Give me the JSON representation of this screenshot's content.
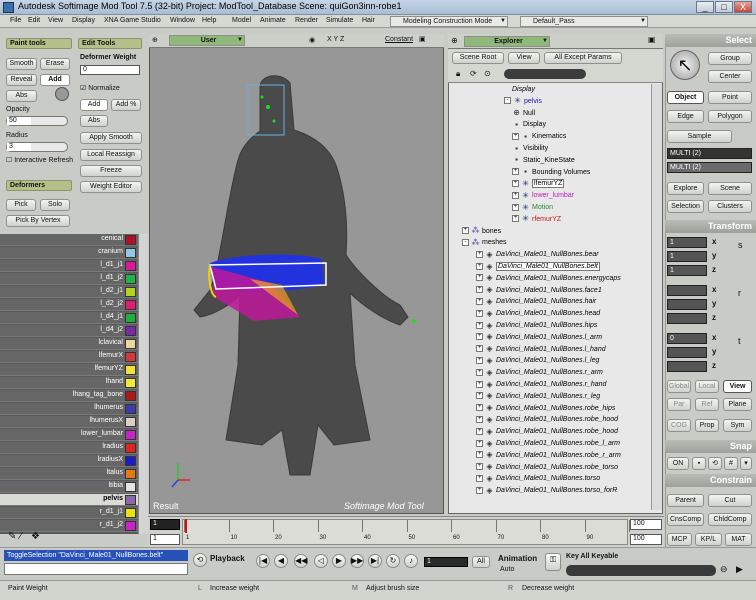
{
  "window": {
    "title": "Autodesk Softimage Mod Tool 7.5 (32-bit)    Project: ModTool_Database    Scene: quiGon3inn-robe1",
    "controls": [
      "_",
      "□",
      "X"
    ]
  },
  "menu": {
    "items": [
      "File",
      "Edit",
      "View",
      "Display",
      "XNA Game Studio",
      "Window",
      "Help",
      "Model",
      "Animate",
      "Render",
      "Simulate",
      "Hair"
    ],
    "mode": "Modeling Construction Mode",
    "pass": "Default_Pass"
  },
  "left": {
    "paint_tools": "Paint tools",
    "edit_tools": "Edit Tools",
    "smooth": "Smooth",
    "erase": "Erase",
    "deformer_weight": "Deformer Weight",
    "deformer_weight_value": "0",
    "reveal": "Reveal",
    "add": "Add",
    "normalize": "Normalize",
    "abs": "Abs",
    "opacity": "Opacity",
    "opacity_value": "50",
    "add2": "Add",
    "add_pct": "Add %",
    "radius": "Radius",
    "radius_value": "3",
    "abs2": "Abs",
    "apply_smooth": "Apply Smooth",
    "interactive_refresh": "Interactive Refresh",
    "local_reassign": "Local Reassign",
    "freeze": "Freeze",
    "deformers": "Deformers",
    "weight_editor": "Weight Editor",
    "pick": "Pick",
    "solo": "Solo",
    "pick_by_vertex": "Pick By Vertex"
  },
  "deformer_list": [
    {
      "name": "cenical",
      "color": "#b0102a"
    },
    {
      "name": "cranium",
      "color": "#8fc8e8"
    },
    {
      "name": "l_d1_j1",
      "color": "#d81a9a"
    },
    {
      "name": "l_d1_j2",
      "color": "#23b34a"
    },
    {
      "name": "l_d2_j1",
      "color": "#b3d41e"
    },
    {
      "name": "l_d2_j2",
      "color": "#e21b73"
    },
    {
      "name": "l_d4_j1",
      "color": "#1fae3a"
    },
    {
      "name": "l_d4_j2",
      "color": "#7a2aa6"
    },
    {
      "name": "lclavical",
      "color": "#e9d6a0"
    },
    {
      "name": "lfemurX",
      "color": "#d33a3a"
    },
    {
      "name": "lfemurYZ",
      "color": "#f0e23a"
    },
    {
      "name": "lhand",
      "color": "#f2e835"
    },
    {
      "name": "lhang_tag_bone",
      "color": "#a81a1a"
    },
    {
      "name": "lhumerus",
      "color": "#3b3ea8"
    },
    {
      "name": "lhumerusX",
      "color": "#d6d0c8"
    },
    {
      "name": "lower_lumbar",
      "color": "#c624c6"
    },
    {
      "name": "lradius",
      "color": "#e02525"
    },
    {
      "name": "lradiusX",
      "color": "#1c1cc8"
    },
    {
      "name": "ltalus",
      "color": "#e47a12"
    },
    {
      "name": "ltibia",
      "color": "#e3e3e3"
    },
    {
      "name": "pelvis",
      "color": "#8a6aa6",
      "selected": true
    },
    {
      "name": "r_d1_j1",
      "color": "#e9e312"
    },
    {
      "name": "r_d1_j2",
      "color": "#cc22cc"
    }
  ],
  "viewport": {
    "camera": "User",
    "axes": "X Y Z",
    "shading": "Constant",
    "result_label": "Result",
    "watermark": "Softimage Mod Tool"
  },
  "explorer": {
    "title": "Explorer",
    "scene_root": "Scene Root",
    "view": "View",
    "filter": "All Except Params",
    "tree": [
      {
        "label": "Display",
        "level": 4,
        "italic": true,
        "icon": "none",
        "color": "#000"
      },
      {
        "label": "pelvis",
        "level": 3,
        "expander": "-",
        "icon": "bone-icon",
        "color": "#1a1ab0"
      },
      {
        "label": "Null",
        "level": 4,
        "icon": "null-icon",
        "color": "#000"
      },
      {
        "label": "Display",
        "level": 4,
        "icon": "prop-icon",
        "color": "#000"
      },
      {
        "label": "Kinematics",
        "level": 4,
        "expander": "+",
        "icon": "prop-icon",
        "color": "#000"
      },
      {
        "label": "Visibility",
        "level": 4,
        "icon": "prop-icon",
        "color": "#000"
      },
      {
        "label": "Static_KineState",
        "level": 4,
        "icon": "prop-icon",
        "color": "#000"
      },
      {
        "label": "Bounding Volumes",
        "level": 4,
        "expander": "+",
        "icon": "prop-icon",
        "color": "#000"
      },
      {
        "label": "lfemurYZ",
        "level": 4,
        "expander": "+",
        "icon": "bone-icon",
        "color": "#000",
        "boxed": true
      },
      {
        "label": "lower_lumbar",
        "level": 4,
        "expander": "+",
        "icon": "bone-icon",
        "color": "#c01ac0"
      },
      {
        "label": "Motion",
        "level": 4,
        "expander": "+",
        "icon": "bone-icon",
        "color": "#2a8a2a"
      },
      {
        "label": "rfemurYZ",
        "level": 4,
        "expander": "+",
        "icon": "bone-icon",
        "color": "#c01a1a"
      },
      {
        "label": "bones",
        "level": 1,
        "expander": "+",
        "icon": "group-icon",
        "color": "#000"
      },
      {
        "label": "meshes",
        "level": 1,
        "expander": "-",
        "icon": "group-icon",
        "color": "#000"
      },
      {
        "label": "DaVinci_Male01_NullBones.bear",
        "level": 2,
        "expander": "+",
        "icon": "mesh-icon",
        "italic": true,
        "color": "#000"
      },
      {
        "label": "DaVinci_Male01_NullBones.belt",
        "level": 2,
        "expander": "+",
        "icon": "mesh-icon",
        "italic": true,
        "color": "#000",
        "boxed": true
      },
      {
        "label": "DaVinci_Male01_NullBones.energycaps",
        "level": 2,
        "expander": "+",
        "icon": "mesh-icon",
        "italic": true,
        "color": "#000"
      },
      {
        "label": "DaVinci_Male01_NullBones.face1",
        "level": 2,
        "expander": "+",
        "icon": "mesh-icon",
        "italic": true,
        "color": "#000"
      },
      {
        "label": "DaVinci_Male01_NullBones.hair",
        "level": 2,
        "expander": "+",
        "icon": "mesh-icon",
        "italic": true,
        "color": "#000"
      },
      {
        "label": "DaVinci_Male01_NullBones.head",
        "level": 2,
        "expander": "+",
        "icon": "mesh-icon",
        "italic": true,
        "color": "#000"
      },
      {
        "label": "DaVinci_Male01_NullBones.hips",
        "level": 2,
        "expander": "+",
        "icon": "mesh-icon",
        "italic": true,
        "color": "#000"
      },
      {
        "label": "DaVinci_Male01_NullBones.l_arm",
        "level": 2,
        "expander": "+",
        "icon": "mesh-icon",
        "italic": true,
        "color": "#000"
      },
      {
        "label": "DaVinci_Male01_NullBones.l_hand",
        "level": 2,
        "expander": "+",
        "icon": "mesh-icon",
        "italic": true,
        "color": "#000"
      },
      {
        "label": "DaVinci_Male01_NullBones.l_leg",
        "level": 2,
        "expander": "+",
        "icon": "mesh-icon",
        "italic": true,
        "color": "#000"
      },
      {
        "label": "DaVinci_Male01_NullBones.r_arm",
        "level": 2,
        "expander": "+",
        "icon": "mesh-icon",
        "italic": true,
        "color": "#000"
      },
      {
        "label": "DaVinci_Male01_NullBones.r_hand",
        "level": 2,
        "expander": "+",
        "icon": "mesh-icon",
        "italic": true,
        "color": "#000"
      },
      {
        "label": "DaVinci_Male01_NullBones.r_leg",
        "level": 2,
        "expander": "+",
        "icon": "mesh-icon",
        "italic": true,
        "color": "#000"
      },
      {
        "label": "DaVinci_Male01_NullBones.robe_hips",
        "level": 2,
        "expander": "+",
        "icon": "mesh-icon",
        "italic": true,
        "color": "#000"
      },
      {
        "label": "DaVinci_Male01_NullBones.robe_hood",
        "level": 2,
        "expander": "+",
        "icon": "mesh-icon",
        "italic": true,
        "color": "#000"
      },
      {
        "label": "DaVinci_Male01_NullBones.robe_hood",
        "level": 2,
        "expander": "+",
        "icon": "mesh-icon",
        "italic": true,
        "color": "#000"
      },
      {
        "label": "DaVinci_Male01_NullBones.robe_l_arm",
        "level": 2,
        "expander": "+",
        "icon": "mesh-icon",
        "italic": true,
        "color": "#000"
      },
      {
        "label": "DaVinci_Male01_NullBones.robe_r_arm",
        "level": 2,
        "expander": "+",
        "icon": "mesh-icon",
        "italic": true,
        "color": "#000"
      },
      {
        "label": "DaVinci_Male01_NullBones.robe_torso",
        "level": 2,
        "expander": "+",
        "icon": "mesh-icon",
        "italic": true,
        "color": "#000"
      },
      {
        "label": "DaVinci_Male01_NullBones.torso",
        "level": 2,
        "expander": "+",
        "icon": "mesh-icon",
        "italic": true,
        "color": "#000"
      },
      {
        "label": "DaVinci_Male01_NullBones.torso_forR",
        "level": 2,
        "expander": "+",
        "icon": "mesh-icon",
        "italic": true,
        "color": "#000"
      }
    ]
  },
  "right": {
    "select": "Select",
    "group": "Group",
    "center": "Center",
    "object": "Object",
    "point": "Point",
    "edge": "Edge",
    "polygon": "Polygon",
    "sample": "Sample",
    "multi1": "MULTI (2)",
    "multi2": "MULTI (2)",
    "explore": "Explore",
    "scene": "Scene",
    "selection": "Selection",
    "clusters": "Clusters",
    "transform": "Transform",
    "x": "x",
    "y": "y",
    "z": "z",
    "scl_x": "1",
    "scl_y": "1",
    "scl_z": "1",
    "rot_x": "0",
    "pos_x": "0",
    "global": "Global",
    "local": "Local",
    "view": "View",
    "par": "Par",
    "ref": "Ref",
    "plane": "Plane",
    "cog": "COG",
    "prop": "Prop",
    "sym": "Sym",
    "snap": "Snap",
    "on": "ON",
    "constrain": "Constrain",
    "parent": "Parent",
    "cut": "Cut",
    "cnscomp": "CnsComp",
    "childcomp": "ChldComp",
    "mcp": "MCP",
    "kpl": "KP/L",
    "mat": "MAT"
  },
  "timeline": {
    "start": "1",
    "start2": "1",
    "end": "100",
    "end2": "100",
    "ticks": [
      "1",
      "10",
      "20",
      "30",
      "40",
      "50",
      "60",
      "70",
      "80",
      "90",
      "100"
    ],
    "current_frame": "1"
  },
  "playback": {
    "script_line": "ToggleSelection \"DaVinci_Male01_NullBones.belt\"",
    "playback": "Playback",
    "frame_value": "1",
    "all": "All",
    "animation": "Animation",
    "auto": "Auto",
    "key_all_keyable": "Key All Keyable"
  },
  "status": {
    "left": "Paint Weight",
    "mid1_key": "L",
    "mid1": "Increase weight",
    "mid2_key": "M",
    "mid2": "Adjust brush size",
    "mid3_key": "R",
    "mid3": "Decrease weight"
  }
}
